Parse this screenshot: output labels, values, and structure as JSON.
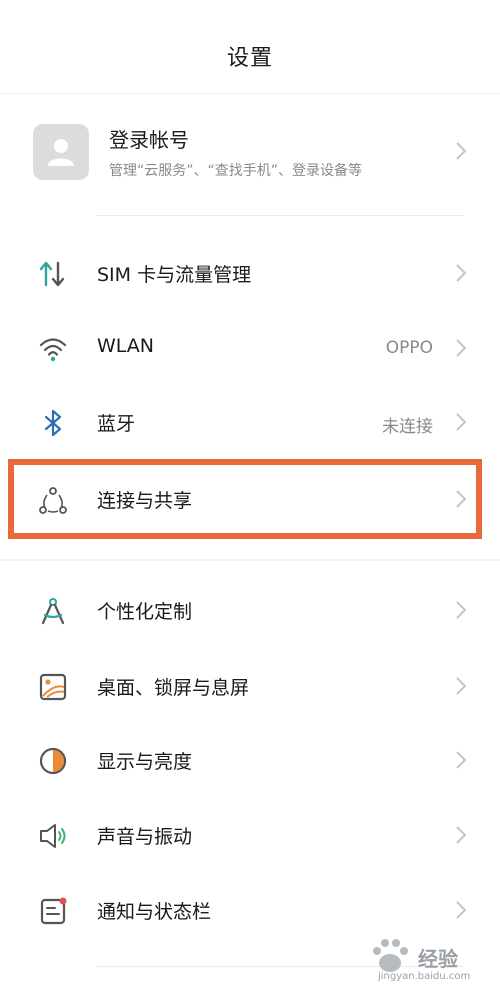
{
  "header": {
    "title": "设置"
  },
  "account": {
    "title": "登录帐号",
    "subtitle": "管理“云服务”、“查找手机”、登录设备等"
  },
  "items": [
    {
      "label": "SIM 卡与流量管理",
      "value": "",
      "icon": "sim-data-icon"
    },
    {
      "label": "WLAN",
      "value": "OPPO",
      "icon": "wifi-icon"
    },
    {
      "label": "蓝牙",
      "value": "未连接",
      "icon": "bluetooth-icon"
    },
    {
      "label": "连接与共享",
      "value": "",
      "icon": "connection-sharing-icon"
    },
    {
      "label": "个性化定制",
      "value": "",
      "icon": "personalization-icon"
    },
    {
      "label": "桌面、锁屏与息屏",
      "value": "",
      "icon": "wallpaper-icon"
    },
    {
      "label": "显示与亮度",
      "value": "",
      "icon": "brightness-icon"
    },
    {
      "label": "声音与振动",
      "value": "",
      "icon": "sound-icon"
    },
    {
      "label": "通知与状态栏",
      "value": "",
      "icon": "notification-icon"
    }
  ],
  "highlight_color": "#e8693c",
  "watermark": {
    "text": "经验",
    "url": "jingyan.baidu.com"
  }
}
